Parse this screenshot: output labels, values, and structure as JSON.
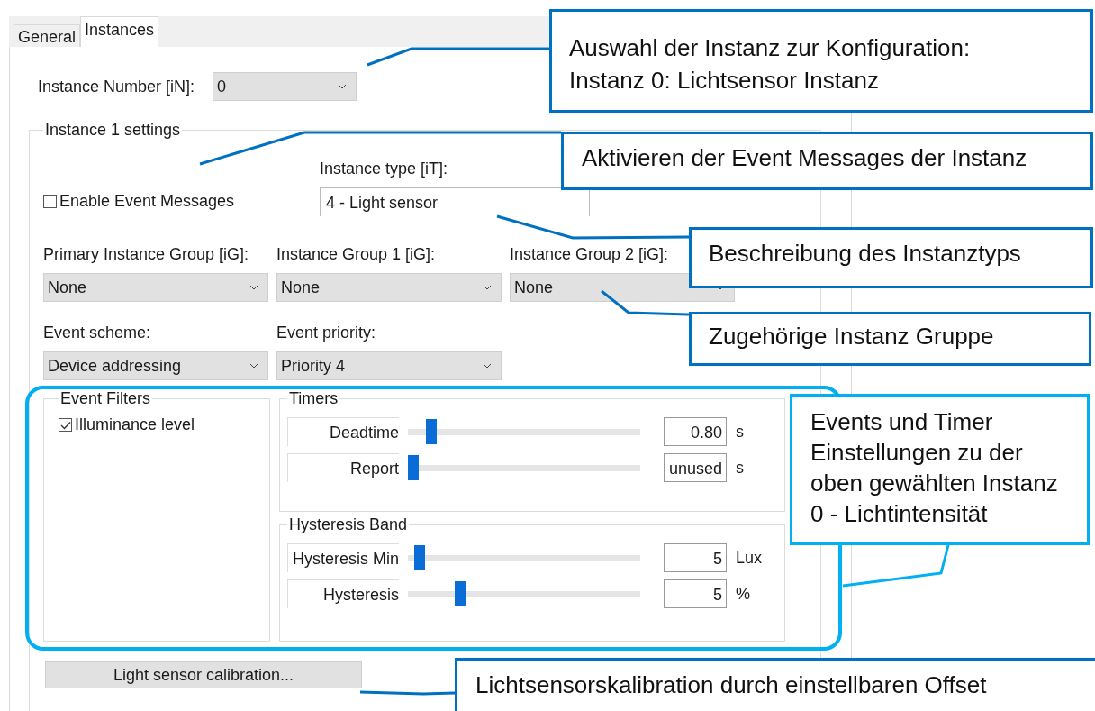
{
  "tabs": [
    {
      "label": "General",
      "selected": false
    },
    {
      "label": "Instances",
      "selected": true
    }
  ],
  "instance_number": {
    "label": "Instance Number [iN]:",
    "value": "0"
  },
  "settings": {
    "title": "Instance 1 settings",
    "enable_event_messages": {
      "label": "Enable Event Messages",
      "checked": false
    },
    "instance_type": {
      "label": "Instance type [iT]:",
      "value": "4 - Light sensor"
    },
    "groups": [
      {
        "label": "Primary Instance Group [iG]:",
        "value": "None"
      },
      {
        "label": "Instance Group 1 [iG]:",
        "value": "None"
      },
      {
        "label": "Instance Group 2 [iG]:",
        "value": "None"
      }
    ],
    "events": [
      {
        "label": "Event scheme:",
        "value": "Device addressing"
      },
      {
        "label": "Event priority:",
        "value": "Priority 4"
      }
    ],
    "event_filters": {
      "title": "Event Filters",
      "items": [
        {
          "label": "Illuminance level",
          "checked": true
        }
      ]
    },
    "timers": {
      "title": "Timers",
      "rows": [
        {
          "label": "Deadtime",
          "level": 0.08,
          "value": "0.80",
          "unit": "s"
        },
        {
          "label": "Report",
          "level": 0.0,
          "value": "unused",
          "unit": "s"
        }
      ]
    },
    "hysteresis_band": {
      "title": "Hysteresis Band",
      "rows": [
        {
          "label": "Hysteresis Min",
          "level": 0.03,
          "value": "5",
          "unit": "Lux"
        },
        {
          "label": "Hysteresis",
          "level": 0.21,
          "value": "5",
          "unit": "%"
        }
      ]
    },
    "calibration_button": "Light sensor calibration..."
  },
  "callouts": [
    {
      "lines": [
        "Auswahl der Instanz zur Konfiguration:",
        "Instanz 0: Lichtsensor Instanz"
      ],
      "color": "#0070c0"
    },
    {
      "lines": [
        "Aktivieren der Event Messages der Instanz"
      ],
      "color": "#0070c0"
    },
    {
      "lines": [
        "Beschreibung des Instanztyps"
      ],
      "color": "#0070c0"
    },
    {
      "lines": [
        "Zugehörige Instanz Gruppe"
      ],
      "color": "#0070c0"
    },
    {
      "lines": [
        "Events und Timer",
        "Einstellungen zu der",
        "oben gewählten Instanz",
        "0 - Lichtintensität"
      ],
      "color": "#00b0f0"
    },
    {
      "lines": [
        "Lichtsensorskalibration durch einstellbaren Offset"
      ],
      "color": "#0070c0"
    }
  ]
}
